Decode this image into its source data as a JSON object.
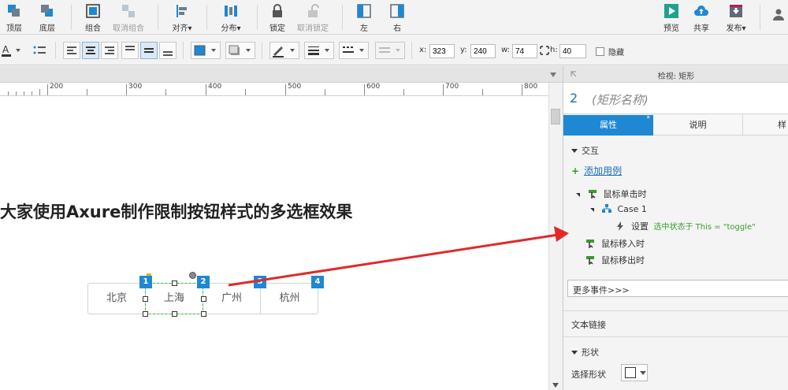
{
  "toolbar": {
    "front": "顶层",
    "back": "底层",
    "group": "组合",
    "ungroup": "取消组合",
    "align": "对齐",
    "distribute": "分布",
    "lock": "锁定",
    "unlock": "取消锁定",
    "left": "左",
    "right": "右",
    "preview": "预览",
    "share": "共享",
    "publish": "发布"
  },
  "format": {
    "x_label": "x:",
    "x_value": "323",
    "y_label": "y:",
    "y_value": "240",
    "w_label": "w:",
    "w_value": "74",
    "h_label": "h:",
    "h_value": "40",
    "hidden_label": "隐藏"
  },
  "ruler": {
    "ticks": [
      "200",
      "300",
      "400",
      "500",
      "600",
      "700",
      "800"
    ]
  },
  "canvas": {
    "heading": "大家使用Axure制作限制按钮样式的多选框效果",
    "buttons": [
      "北京",
      "上海",
      "广州",
      "杭州"
    ],
    "badges": [
      "1",
      "2",
      "3",
      "4"
    ]
  },
  "panel": {
    "title": "检视: 矩形",
    "widget_number": "2",
    "widget_name": "(矩形名称)",
    "tabs": [
      "属性",
      "说明",
      "样"
    ],
    "interaction_header": "交互",
    "add_case": "添加用例",
    "on_click": "鼠标单击时",
    "case_label": "Case 1",
    "action_prefix": "设置",
    "action_text": "选中状态于 This = \"toggle\"",
    "on_mouse_enter": "鼠标移入时",
    "on_mouse_leave": "鼠标移出时",
    "more_events": "更多事件>>>",
    "text_link": "文本链接",
    "shape_header": "形状",
    "select_shape": "选择形状"
  },
  "colors": {
    "accent": "#1e88d2",
    "action_green": "#3a9b2b",
    "arrow_red": "#e02a2a",
    "selection_green": "#35c335"
  }
}
